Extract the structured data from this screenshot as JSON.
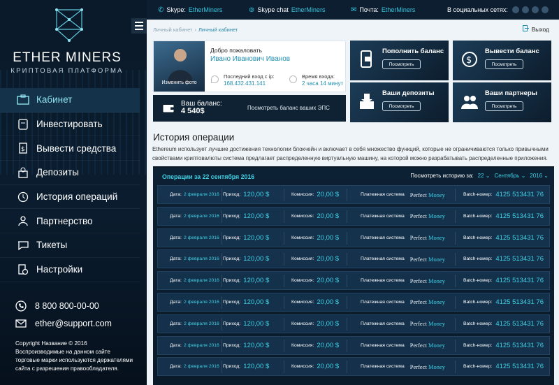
{
  "brand": {
    "name_part1": "ETHER",
    "name_part2": " MINERS",
    "tagline": "КРИПТОВАЯ ПЛАТФОРМА"
  },
  "sidebar": {
    "items": [
      {
        "label": "Кабинет",
        "icon": "cabinet-icon",
        "active": true
      },
      {
        "label": "Инвестировать",
        "icon": "invest-icon"
      },
      {
        "label": "Вывести средства",
        "icon": "withdraw-icon"
      },
      {
        "label": "Депозиты",
        "icon": "deposits-icon"
      },
      {
        "label": "История операций",
        "icon": "history-icon"
      },
      {
        "label": "Партнерство",
        "icon": "partners-icon"
      },
      {
        "label": "Тикеты",
        "icon": "tickets-icon"
      },
      {
        "label": "Настройки",
        "icon": "settings-icon"
      }
    ]
  },
  "contacts": {
    "phone": "8 800 800-00-00",
    "email": "ether@support.com"
  },
  "copyright": "Copyright Название  ©  2016 Воспроизводимые на данном сайте торговые марки используются держателями сайта с разрешения правообладателя.",
  "topbar": {
    "skype_label": "Skype:",
    "skype_value": "EtherMiners",
    "skype_chat_label": "Skype chat",
    "skype_chat_value": "EtherMiners",
    "mail_label": "Почта:",
    "mail_value": "EtherMiners",
    "social_label": "В социальных сетях:"
  },
  "breadcrumb": {
    "root": "Личный кабинет",
    "sep": "›",
    "current": "Личный кабинет"
  },
  "exit_label": "Выход",
  "profile": {
    "avatar_caption": "Изменить фото",
    "welcome": "Добро пожаловать",
    "name": "Ивано Иванович Иванов",
    "last_login_label": "Последний вход с ip:",
    "last_login_ip": "168.432.431.141",
    "time_label": "Время входа:",
    "time_value": "2 часа 14 минут"
  },
  "balance": {
    "label": "Ваш баланс:",
    "value": "4 540$",
    "link": "Посмотреть баланс ваших ЭПС"
  },
  "tiles": [
    {
      "title": "Пополнить баланс",
      "button": "Посмотреть",
      "icon": "wallet-phone-icon"
    },
    {
      "title": "Вывести баланс",
      "button": "Посмотреть",
      "icon": "dollar-refresh-icon"
    },
    {
      "title": "Ваши депозиты",
      "button": "Посмотреть",
      "icon": "deposit-box-icon"
    },
    {
      "title": "Ваши партнеры",
      "button": "Посмотреть",
      "icon": "partners-icon"
    }
  ],
  "history": {
    "title": "История операции",
    "description": "Ethereum использует лучшие достижения технологии блокчейн  и включает в себя множество функций, которые не ограничиваются только привычными свойствами криптовалюты система предлагает распределенную виртуальную машину, на которой можно разрабатывать распределенные приложения.",
    "ops_title": "Операции за 22 сентября 2016",
    "filter_label": "Посмотреть историю за:",
    "filter_day": "22",
    "filter_month": "Сентябрь",
    "filter_year": "2016"
  },
  "row_labels": {
    "date": "Дата:",
    "income": "Приход:",
    "fee": "Комиссия:",
    "system": "Платежная система",
    "batch": "Batch-номер:"
  },
  "operations": [
    {
      "date": "2 февраля 2016",
      "income": "120,00 $",
      "fee": "20,00 $",
      "system_a": "Perfect",
      "system_b": "Money",
      "batch": "4125 513431 76"
    },
    {
      "date": "2 февраля 2016",
      "income": "120,00 $",
      "fee": "20,00 $",
      "system_a": "Perfect",
      "system_b": "Money",
      "batch": "4125 513431 76"
    },
    {
      "date": "2 февраля 2016",
      "income": "120,00 $",
      "fee": "20,00 $",
      "system_a": "Perfect",
      "system_b": "Money",
      "batch": "4125 513431 76"
    },
    {
      "date": "2 февраля 2016",
      "income": "120,00 $",
      "fee": "20,00 $",
      "system_a": "Perfect",
      "system_b": "Money",
      "batch": "4125 513431 76"
    },
    {
      "date": "2 февраля 2016",
      "income": "120,00 $",
      "fee": "20,00 $",
      "system_a": "Perfect",
      "system_b": "Money",
      "batch": "4125 513431 76"
    },
    {
      "date": "2 февраля 2016",
      "income": "120,00 $",
      "fee": "20,00 $",
      "system_a": "Perfect",
      "system_b": "Money",
      "batch": "4125 513431 76"
    },
    {
      "date": "2 февраля 2016",
      "income": "120,00 $",
      "fee": "20,00 $",
      "system_a": "Perfect",
      "system_b": "Money",
      "batch": "4125 513431 76"
    },
    {
      "date": "2 февраля 2016",
      "income": "120,00 $",
      "fee": "20,00 $",
      "system_a": "Perfect",
      "system_b": "Money",
      "batch": "4125 513431 76"
    },
    {
      "date": "2 февраля 2016",
      "income": "120,00 $",
      "fee": "20,00 $",
      "system_a": "Perfect",
      "system_b": "Money",
      "batch": "4125 513431 76"
    }
  ],
  "colors": {
    "accent": "#3fd0e4",
    "link": "#1e8db0",
    "dark": "#0d1e30"
  }
}
